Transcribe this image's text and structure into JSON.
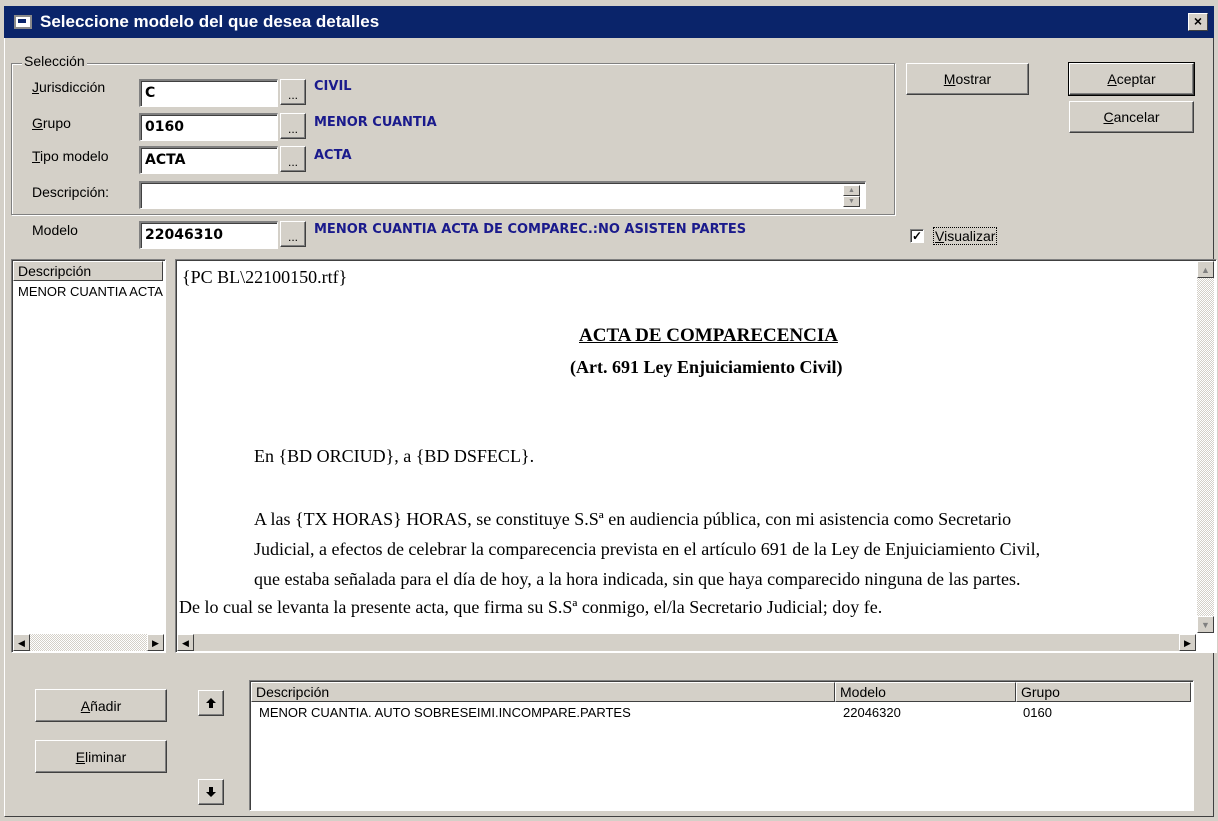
{
  "window": {
    "title": "Seleccione modelo del que desea detalles",
    "close_glyph": "×"
  },
  "seleccion": {
    "group_label": "Selección",
    "jurisdiccion": {
      "label": "Jurisdicción",
      "value": "C",
      "description": "CIVIL"
    },
    "grupo": {
      "label": "Grupo",
      "value": "0160",
      "description": "MENOR CUANTIA"
    },
    "tipo_modelo": {
      "label": "Tipo modelo",
      "value": "ACTA",
      "description": "ACTA"
    },
    "descripcion": {
      "label": "Descripción:",
      "value": ""
    },
    "browse_label": "..."
  },
  "modelo": {
    "label": "Modelo",
    "value": "22046310",
    "description": "MENOR CUANTIA ACTA DE COMPAREC.:NO ASISTEN PARTES"
  },
  "buttons": {
    "mostrar": "Mostrar",
    "aceptar": "Aceptar",
    "cancelar": "Cancelar",
    "anadir": "Añadir",
    "eliminar": "Eliminar"
  },
  "visualizar": {
    "label": "Visualizar",
    "checked": true,
    "check_glyph": "✓"
  },
  "left_list": {
    "header": "Descripción",
    "items": [
      "MENOR CUANTIA ACTA DE COMPAREC.:NO ASISTEN PARTES"
    ]
  },
  "preview": {
    "path_line": "{PC BL\\22100150.rtf}",
    "heading": "ACTA DE COMPARECENCIA",
    "subheading": "(Art. 691 Ley Enjuiciamiento Civil)",
    "line1": "En {BD ORCIUD}, a {BD DSFECL}.",
    "line2": "A las {TX HORAS} HORAS, se constituye S.Sª en audiencia pública, con mi asistencia como Secretario",
    "line3": "Judicial, a efectos de celebrar la comparecencia prevista en el artículo 691 de la Ley de Enjuiciamiento Civil,",
    "line4": "que estaba señalada para el día de hoy, a la hora indicada, sin que haya comparecido ninguna de las partes.",
    "line5": "De lo cual se levanta la presente acta, que firma su S.Sª conmigo, el/la Secretario Judicial; doy fe."
  },
  "bottom_table": {
    "columns": [
      "Descripción",
      "Modelo",
      "Grupo"
    ],
    "rows": [
      {
        "descripcion": "MENOR CUANTIA. AUTO SOBRESEIMI.INCOMPARE.PARTES",
        "modelo": "22046320",
        "grupo": "0160"
      }
    ]
  },
  "icons": {
    "arrow_up": "arrow-up-icon",
    "arrow_down": "arrow-down-icon",
    "scroll_left": "◀",
    "scroll_right": "▶",
    "scroll_up": "▲",
    "scroll_down": "▼",
    "up_glyph": "🡑",
    "down_glyph": "🡓"
  }
}
